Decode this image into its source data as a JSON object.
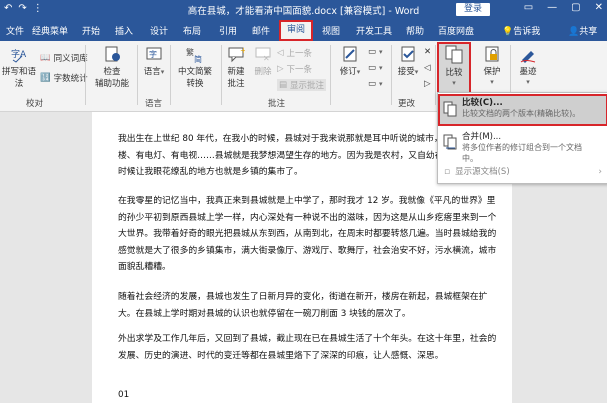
{
  "titlebar": {
    "title": "高在县城，才能看清中国面貌.docx [兼容模式] - Word",
    "login": "登录",
    "qat": [
      "↶",
      "↷",
      "⋮"
    ],
    "win": [
      "▭",
      "—",
      "▢",
      "✕"
    ]
  },
  "tabs": [
    "文件",
    "经典菜单",
    "开始",
    "插入",
    "设计",
    "布局",
    "引用",
    "邮件",
    "审阅",
    "视图",
    "开发工具",
    "帮助",
    "百度网盘",
    "告诉我",
    "共享"
  ],
  "ribbon": {
    "g_proofing": {
      "btn1": "拼写和语法",
      "row1": "同义词库",
      "row2": "字数统计",
      "group": "校对"
    },
    "g_access": {
      "btn": "检查\n辅助功能",
      "group": "辅助功能"
    },
    "g_lang": {
      "btn": "语言",
      "group": "语言"
    },
    "g_chinese": {
      "btn": "中文简繁\n转换",
      "group": "中文简繁转换"
    },
    "g_comments": {
      "new": "新建\n批注",
      "del": "删除",
      "prev": "上一条",
      "next": "下一条",
      "show": "显示批注",
      "group": "批注"
    },
    "g_track": {
      "btn": "修订",
      "group": "修订"
    },
    "g_changes": {
      "accept": "接受",
      "group": "更改"
    },
    "g_compare": {
      "btn": "比较",
      "group": "比较"
    },
    "g_protect": {
      "btn": "保护"
    },
    "g_ink": {
      "btn": "墨迹"
    }
  },
  "dropdown": {
    "item1": {
      "title": "比较(C)...",
      "desc": "比较文档的两个版本(精确比较)。"
    },
    "item2": {
      "title": "合并(M)...",
      "desc": "将多位作者的修订组合到一个文档中。"
    },
    "item3": {
      "title": "显示源文档(S)"
    }
  },
  "doc": {
    "p1": "我出生在上世纪 80 年代，在我小的时候，县城对于我来说那就是耳中听说的城市，城有车、有楼、有电灯、有电视……县城就是我梦想渴望生存的地方。因为我是农村，又自幼在农村长大，小时候让我眼花缭乱的地方也就是乡镇的集市了。",
    "p2": "在我零星的记忆当中，我真正来到县城就是上中学了，那时我才 12 岁。我就像《平凡的世界》里的孙少平初到原西县城上学一样，内心深处有一种说不出的滋味，因为这是从山乡疙瘩里来到一个大世界。我带着好奇的眼光把县城从东到西，从南到北，在周末时都要转悠几遍。当时县城给我的感觉就是大了很多的乡镇集市，满大街录像厅、游戏厅、歌舞厅，社会治安不好，污水横流，城市面貌乱糟糟。",
    "p3": "随着社会经济的发展，县城也发生了日新月异的变化，街道在新开，楼房在新起，县城框架在扩大。在县城上学时期对县城的认识也就停留在一碗刀削面 3 块钱的层次了。",
    "p4": "外出求学及工作几年后，又回到了县城，截止现在已在县城生活了十个年头。在这十年里，社会的发展、历史的演进、时代的变迁等都在县城里烙下了深深的印痕，让人感慨、深思。",
    "p5": "01"
  }
}
